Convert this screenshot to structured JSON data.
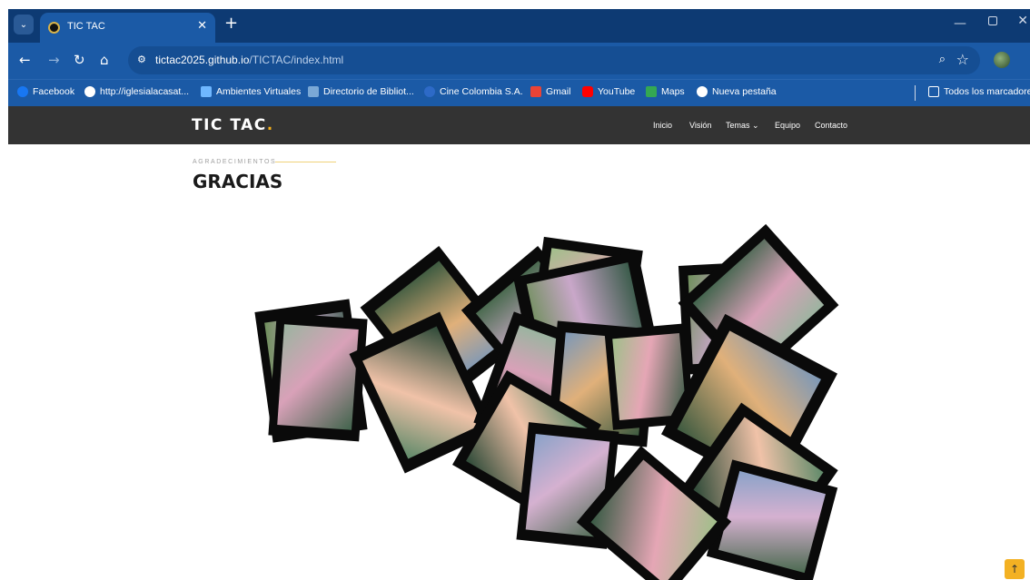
{
  "browser": {
    "tab_title": "TIC TAC",
    "url_host": "tictac2025.github.io",
    "url_path": "/TICTAC/index.html",
    "bookmarks": [
      {
        "label": "Facebook",
        "icon": "facebook-icon",
        "color": "#1877f2"
      },
      {
        "label": "http://iglesialacasat...",
        "icon": "globe-icon",
        "color": "#ffffff"
      },
      {
        "label": "Ambientes Virtuales",
        "icon": "ambientes-icon",
        "color": "#6fb7ff"
      },
      {
        "label": "Directorio de Bibliot...",
        "icon": "library-icon",
        "color": "#7aa8d6"
      },
      {
        "label": "Cine Colombia S.A.",
        "icon": "cine-icon",
        "color": "#2d6ac7"
      },
      {
        "label": "Gmail",
        "icon": "gmail-icon",
        "color": "#ea4335"
      },
      {
        "label": "YouTube",
        "icon": "youtube-icon",
        "color": "#ff0000"
      },
      {
        "label": "Maps",
        "icon": "maps-icon",
        "color": "#34a853"
      },
      {
        "label": "Nueva pestaña",
        "icon": "globe-icon",
        "color": "#ffffff"
      }
    ],
    "all_bookmarks": "Todos los marcadores"
  },
  "site": {
    "logo_text": "TIC TAC",
    "logo_dot": ".",
    "nav": [
      "Inicio",
      "Visión",
      "Temas ⌄",
      "Equipo",
      "Contacto"
    ],
    "eyebrow": "AGRADECIMIENTOS",
    "title": "GRACIAS",
    "accent_color": "#f6b11a"
  }
}
